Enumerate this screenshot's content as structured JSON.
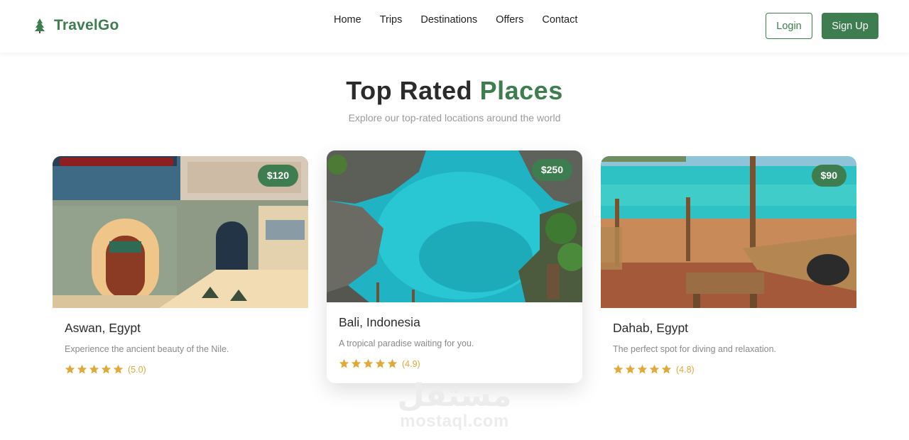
{
  "brand": {
    "name": "TravelGo",
    "icon": "tree-icon",
    "color": "#3d7d4f"
  },
  "nav": {
    "items": [
      {
        "label": "Home"
      },
      {
        "label": "Trips"
      },
      {
        "label": "Destinations"
      },
      {
        "label": "Offers"
      },
      {
        "label": "Contact"
      }
    ]
  },
  "auth": {
    "login_label": "Login",
    "signup_label": "Sign Up"
  },
  "section": {
    "title_main": "Top Rated",
    "title_accent": "Places",
    "subtitle": "Explore our top-rated locations around the world"
  },
  "cards": [
    {
      "title": "Aswan, Egypt",
      "description": "Experience the ancient beauty of the Nile.",
      "price": "$120",
      "rating_text": "(5.0)",
      "rating": 5.0,
      "stars": 5
    },
    {
      "title": "Bali, Indonesia",
      "description": "A tropical paradise waiting for you.",
      "price": "$250",
      "rating_text": "(4.9)",
      "rating": 4.9,
      "stars": 5
    },
    {
      "title": "Dahab, Egypt",
      "description": "The perfect spot for diving and relaxation.",
      "price": "$90",
      "rating_text": "(4.8)",
      "rating": 4.8,
      "stars": 5
    }
  ],
  "watermark": {
    "arabic": "مستقل",
    "latin": "mostaql.com"
  },
  "colors": {
    "accent": "#3d7d4f",
    "star": "#e0a93a",
    "subtitle": "#9a9a9a"
  }
}
